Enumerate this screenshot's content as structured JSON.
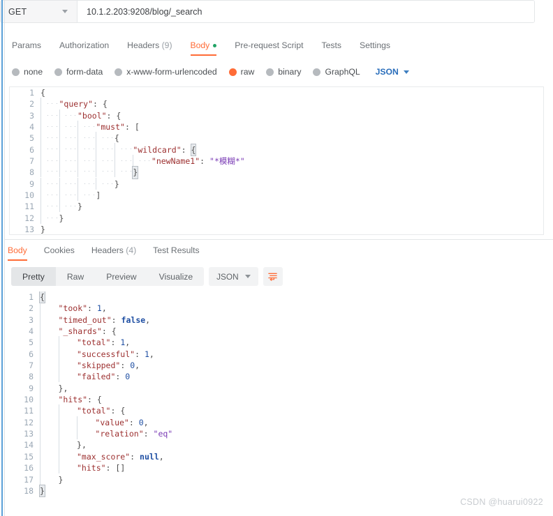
{
  "request": {
    "method": "GET",
    "url": "10.1.2.203:9208/blog/_search",
    "tabs": [
      {
        "label": "Params",
        "active": false,
        "badge": ""
      },
      {
        "label": "Authorization",
        "active": false,
        "badge": ""
      },
      {
        "label": "Headers",
        "active": false,
        "badge": "(9)"
      },
      {
        "label": "Body",
        "active": true,
        "badge": ""
      },
      {
        "label": "Pre-request Script",
        "active": false,
        "badge": ""
      },
      {
        "label": "Tests",
        "active": false,
        "badge": ""
      },
      {
        "label": "Settings",
        "active": false,
        "badge": ""
      }
    ],
    "body_modes": [
      {
        "label": "none",
        "selected": false
      },
      {
        "label": "form-data",
        "selected": false
      },
      {
        "label": "x-www-form-urlencoded",
        "selected": false
      },
      {
        "label": "raw",
        "selected": true
      },
      {
        "label": "binary",
        "selected": false
      },
      {
        "label": "GraphQL",
        "selected": false
      }
    ],
    "raw_format": "JSON",
    "body_lines": [
      "{",
      "    \"query\": {",
      "        \"bool\": {",
      "            \"must\": [",
      "                {",
      "                    \"wildcard\": {",
      "                        \"newName1\": \"*模糊*\"",
      "                    }",
      "                }",
      "            ]",
      "        }",
      "    }",
      "}"
    ]
  },
  "response": {
    "tabs": [
      {
        "label": "Body",
        "active": true,
        "badge": ""
      },
      {
        "label": "Cookies",
        "active": false,
        "badge": ""
      },
      {
        "label": "Headers",
        "active": false,
        "badge": "(4)"
      },
      {
        "label": "Test Results",
        "active": false,
        "badge": ""
      }
    ],
    "views": [
      {
        "label": "Pretty",
        "active": true
      },
      {
        "label": "Raw",
        "active": false
      },
      {
        "label": "Preview",
        "active": false
      },
      {
        "label": "Visualize",
        "active": false
      }
    ],
    "format": "JSON",
    "beautify_title": "Beautify",
    "body_lines": [
      "{",
      "    \"took\": 1,",
      "    \"timed_out\": false,",
      "    \"_shards\": {",
      "        \"total\": 1,",
      "        \"successful\": 1,",
      "        \"skipped\": 0,",
      "        \"failed\": 0",
      "    },",
      "    \"hits\": {",
      "        \"total\": {",
      "            \"value\": 0,",
      "            \"relation\": \"eq\"",
      "        },",
      "        \"max_score\": null,",
      "        \"hits\": []",
      "    }",
      "}"
    ]
  },
  "watermark": "CSDN @huarui0922",
  "colors": {
    "accent": "#ff6c37",
    "green_dot": "#21a366",
    "key": "#9c2f2f",
    "string": "#7a3bb5",
    "number": "#1f4fa3",
    "rail": "#5aa0d8"
  }
}
